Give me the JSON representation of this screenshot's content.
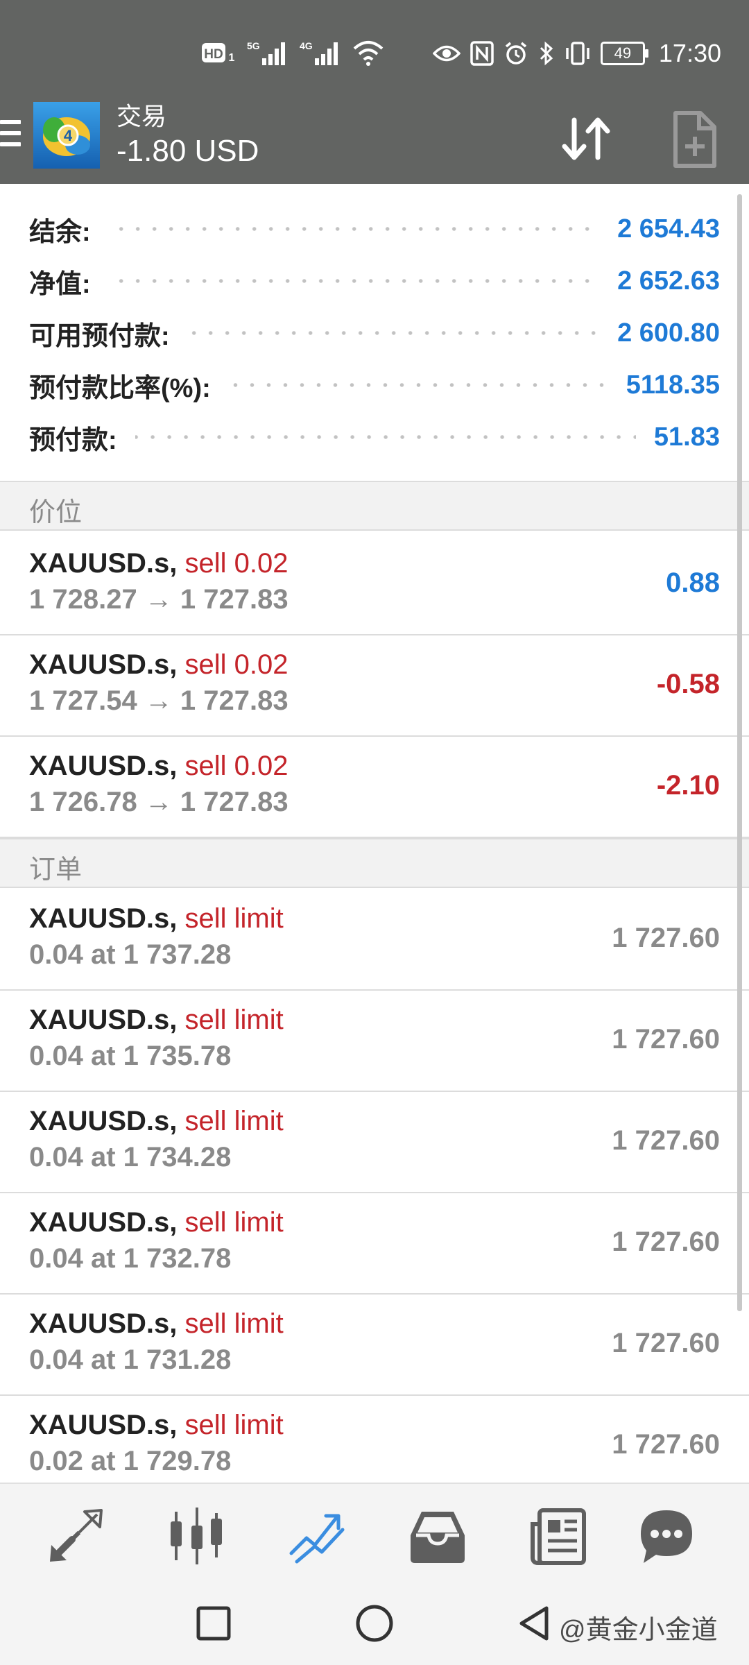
{
  "status_bar": {
    "time": "17:30",
    "battery": "49",
    "signal_labels": [
      "HD",
      "5G",
      "4G"
    ],
    "icons": [
      "hd-volte-icon",
      "5g-signal-icon",
      "4g-signal-icon",
      "wifi-icon",
      "eye-icon",
      "nfc-icon",
      "alarm-icon",
      "bluetooth-icon",
      "vibrate-icon",
      "battery-icon"
    ]
  },
  "app_bar": {
    "title": "交易",
    "subtitle": "-1.80 USD"
  },
  "summary": [
    {
      "label": "结余:",
      "value": "2 654.43"
    },
    {
      "label": "净值:",
      "value": "2 652.63"
    },
    {
      "label": "可用预付款:",
      "value": "2 600.80"
    },
    {
      "label": "预付款比率(%):",
      "value": "5118.35"
    },
    {
      "label": "预付款:",
      "value": "51.83"
    }
  ],
  "positions_header": "价位",
  "positions": [
    {
      "symbol": "XAUUSD.s,",
      "action": "sell 0.02",
      "prices": "1 728.27 → 1 727.83",
      "profit": "0.88",
      "tone": "positive"
    },
    {
      "symbol": "XAUUSD.s,",
      "action": "sell 0.02",
      "prices": "1 727.54 → 1 727.83",
      "profit": "-0.58",
      "tone": "negative"
    },
    {
      "symbol": "XAUUSD.s,",
      "action": "sell 0.02",
      "prices": "1 726.78 → 1 727.83",
      "profit": "-2.10",
      "tone": "negative"
    }
  ],
  "orders_header": "订单",
  "orders": [
    {
      "symbol": "XAUUSD.s,",
      "action": "sell limit",
      "detail": "0.04 at 1 737.28",
      "current": "1 727.60"
    },
    {
      "symbol": "XAUUSD.s,",
      "action": "sell limit",
      "detail": "0.04 at 1 735.78",
      "current": "1 727.60"
    },
    {
      "symbol": "XAUUSD.s,",
      "action": "sell limit",
      "detail": "0.04 at 1 734.28",
      "current": "1 727.60"
    },
    {
      "symbol": "XAUUSD.s,",
      "action": "sell limit",
      "detail": "0.04 at 1 732.78",
      "current": "1 727.60"
    },
    {
      "symbol": "XAUUSD.s,",
      "action": "sell limit",
      "detail": "0.04 at 1 731.28",
      "current": "1 727.60"
    },
    {
      "symbol": "XAUUSD.s,",
      "action": "sell limit",
      "detail": "0.02 at 1 729.78",
      "current": "1 727.60"
    }
  ],
  "bottom_tabs": [
    {
      "name": "quotes-tab",
      "icon": "arrows-diagonal-icon",
      "active": false
    },
    {
      "name": "chart-tab",
      "icon": "candlestick-icon",
      "active": false
    },
    {
      "name": "trade-tab",
      "icon": "trend-lines-icon",
      "active": true
    },
    {
      "name": "history-tab",
      "icon": "inbox-tray-icon",
      "active": false
    },
    {
      "name": "news-tab",
      "icon": "newspaper-icon",
      "active": false
    },
    {
      "name": "chat-tab",
      "icon": "chat-bubble-icon",
      "active": false
    }
  ],
  "watermark": "@黄金小金道",
  "colors": {
    "bar_bg": "#626462",
    "positive": "#1e7ad6",
    "negative": "#c4242a",
    "muted": "#8a8a8a",
    "active_tab": "#3a8de0"
  }
}
